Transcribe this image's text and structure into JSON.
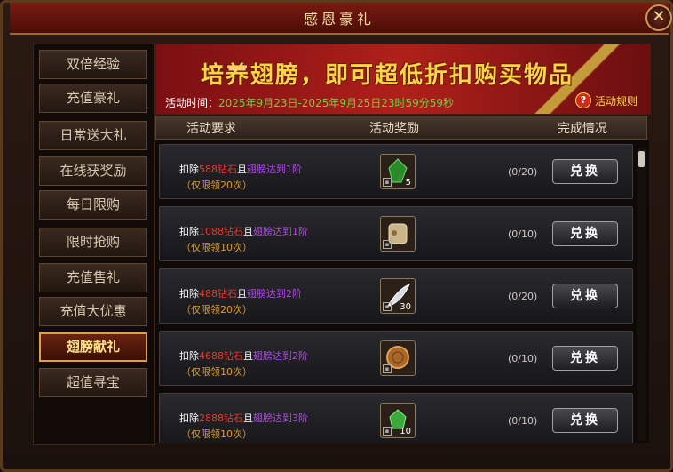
{
  "window": {
    "title": "感恩豪礼",
    "close_glyph": "✕"
  },
  "sidebar": {
    "items": [
      {
        "label": "双倍经验",
        "active": false
      },
      {
        "label": "充值豪礼",
        "active": false
      },
      {
        "label": "日常送大礼",
        "active": false
      },
      {
        "label": "在线获奖励",
        "active": false
      },
      {
        "label": "每日限购",
        "active": false
      },
      {
        "label": "限时抢购",
        "active": false
      },
      {
        "label": "充值售礼",
        "active": false
      },
      {
        "label": "充值大优惠",
        "active": false
      },
      {
        "label": "翅膀献礼",
        "active": true
      },
      {
        "label": "超值寻宝",
        "active": false
      }
    ]
  },
  "banner": {
    "slogan": "培养翅膀，即可超低折扣购买物品",
    "period_label": "活动时间：",
    "period_value": "2025年9月23日-2025年9月25日23时59分59秒",
    "rules_label": "活动规则",
    "rules_icon": "question-icon"
  },
  "table": {
    "col_requirement": "活动要求",
    "col_reward": "活动奖励",
    "col_status": "完成情况",
    "rows": [
      {
        "prefix": "扣除",
        "diamonds": "588钻石",
        "and": "且",
        "wing": "翅膀达到1阶",
        "limit": "（仅限领20次）",
        "item_icon": "green-gem-icon",
        "item_color": "#2a8a2a",
        "qty": "5",
        "progress": "(0/20)",
        "button": "兑换"
      },
      {
        "prefix": "扣除",
        "diamonds": "1088钻石",
        "and": "且",
        "wing": "翅膀达到1阶",
        "limit": "（仅限领10次）",
        "item_icon": "scroll-icon",
        "item_color": "#c8b488",
        "qty": "",
        "progress": "(0/10)",
        "button": "兑换"
      },
      {
        "prefix": "扣除",
        "diamonds": "488钻石",
        "and": "且",
        "wing": "翅膀达到2阶",
        "limit": "（仅限领20次）",
        "item_icon": "feather-icon",
        "item_color": "#d8dce4",
        "qty": "30",
        "progress": "(0/20)",
        "button": "兑换"
      },
      {
        "prefix": "扣除",
        "diamonds": "4688钻石",
        "and": "且",
        "wing": "翅膀达到2阶",
        "limit": "（仅限领10次）",
        "item_icon": "coin-icon",
        "item_color": "#a8662a",
        "qty": "",
        "progress": "(0/10)",
        "button": "兑换"
      },
      {
        "prefix": "扣除",
        "diamonds": "2888钻石",
        "and": "且",
        "wing": "翅膀达到3阶",
        "limit": "（仅限领10次）",
        "item_icon": "green-gem-icon",
        "item_color": "#3aa83a",
        "qty": "10",
        "progress": "(0/10)",
        "button": "兑换"
      }
    ]
  }
}
